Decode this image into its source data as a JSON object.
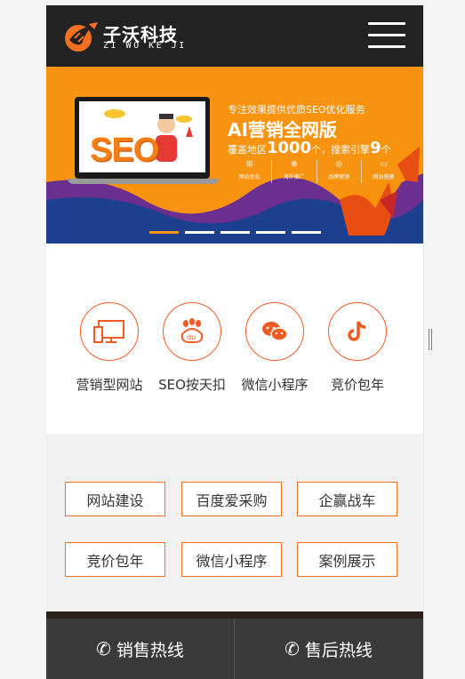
{
  "brand": {
    "name": "子沃科技",
    "subtitle": "ZI WO KE JI",
    "accent": "#f37021",
    "header_bg": "#222222"
  },
  "menu": {
    "icon": "hamburger-menu-icon"
  },
  "banner": {
    "seo_word": "SEO",
    "subtitle": "专注效果提供优质SEO优化服务",
    "title": "AI营销全网版",
    "coverage_prefix": "覆盖地区",
    "coverage_number": "1000",
    "coverage_unit": "个，搜索引擎",
    "engine_number": "9",
    "engine_unit": "个",
    "features": [
      {
        "icon": "grid-icon",
        "label": "网站优化"
      },
      {
        "icon": "globe-icon",
        "label": "海外推广"
      },
      {
        "icon": "brand-icon",
        "label": "品牌营销"
      },
      {
        "icon": "monitor-icon",
        "label": "网站搭建"
      }
    ],
    "slides": 5,
    "active_slide": 1
  },
  "services": [
    {
      "icon": "desktop-mobile-icon",
      "label": "营销型网站"
    },
    {
      "icon": "baidu-paw-icon",
      "label": "SEO按天扣"
    },
    {
      "icon": "wechat-icon",
      "label": "微信小程序"
    },
    {
      "icon": "tiktok-icon",
      "label": "竞价包年"
    }
  ],
  "tags": [
    "网站建设",
    "百度爱采购",
    "企赢战车",
    "竞价包年",
    "微信小程序",
    "案例展示"
  ],
  "footer": {
    "sales": "销售热线",
    "aftersales": "售后热线",
    "icon": "phone-icon"
  }
}
